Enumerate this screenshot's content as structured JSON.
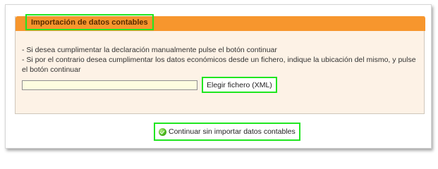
{
  "panel": {
    "title": "Importación de datos contables",
    "instructions": [
      "- Si desea cumplimentar la declaración manualmente pulse el botón continuar",
      "- Si por el contrario desea cumplimentar los datos económicos desde un fichero, indique la ubicación del mismo, y pulse el botón continuar"
    ],
    "file_input": {
      "value": "",
      "placeholder": ""
    },
    "choose_file_label": "Elegir fichero (XML)"
  },
  "footer": {
    "continue_label": "Continuar sin importar datos contables",
    "continue_icon": "check-circle-icon"
  },
  "colors": {
    "header": "#f7962d",
    "panel_background": "#fdf2e6",
    "input_background": "#fdfde0",
    "highlight": "#20e620"
  }
}
